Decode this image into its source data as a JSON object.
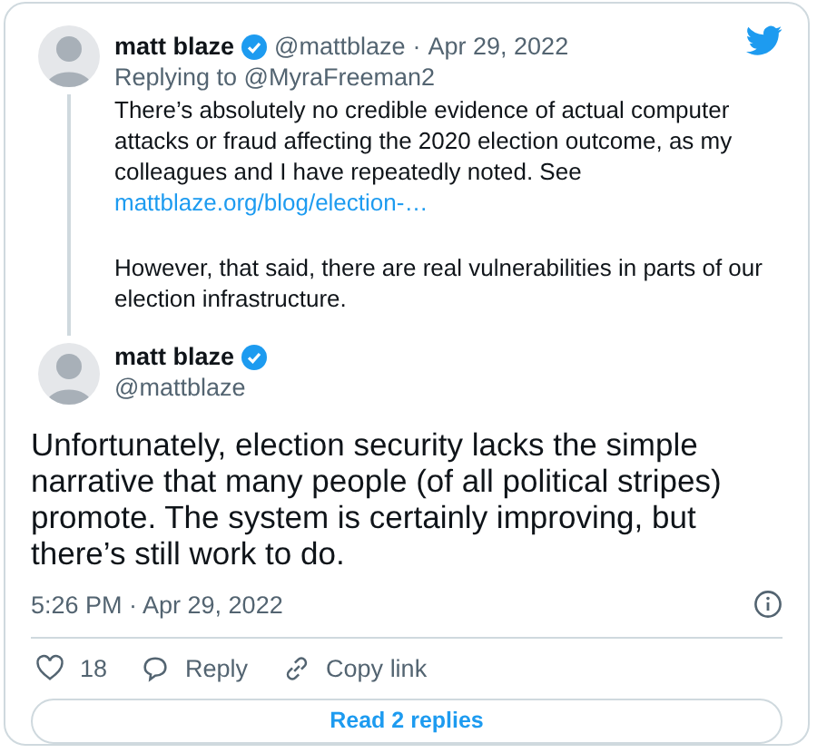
{
  "parent_tweet": {
    "author": "matt blaze",
    "verified": true,
    "handle": "@mattblaze",
    "separator": "·",
    "date": "Apr 29, 2022",
    "replying_to": "Replying to @MyraFreeman2",
    "paragraphs": [
      {
        "text": "There’s absolutely no credible evidence of actual computer attacks or fraud affecting the 2020 election outcome, as my colleagues and I have repeatedly noted. See",
        "link": "mattblaze.org/blog/election-…"
      },
      {
        "text": "However, that said, there are real vulnerabilities in parts of our election infrastructure."
      }
    ]
  },
  "main_tweet": {
    "author": "matt blaze",
    "verified": true,
    "handle": "@mattblaze",
    "text": "Unfortunately, election security lacks the simple narrative that many people (of all political stripes) promote. The system is certainly improving, but there’s still work to do.",
    "timestamp": "5:26 PM · Apr 29, 2022"
  },
  "actions": [
    {
      "kind": "like",
      "label": "18"
    },
    {
      "kind": "reply",
      "label": "Reply"
    },
    {
      "kind": "copy",
      "label": "Copy link"
    }
  ],
  "read_replies": "Read 2 replies"
}
